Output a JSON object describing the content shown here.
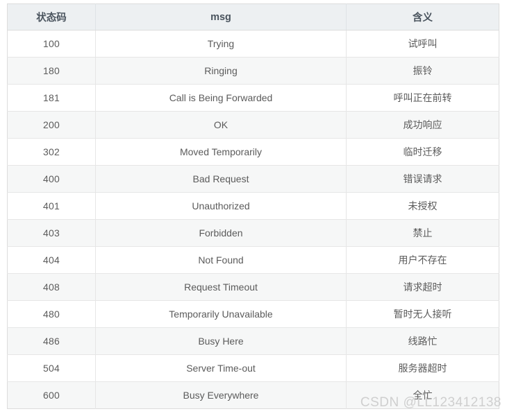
{
  "table": {
    "columns": [
      "状态码",
      "msg",
      "含义"
    ],
    "rows": [
      {
        "code": "100",
        "msg": "Trying",
        "meaning": "试呼叫"
      },
      {
        "code": "180",
        "msg": "Ringing",
        "meaning": "振铃"
      },
      {
        "code": "181",
        "msg": "Call is Being Forwarded",
        "meaning": "呼叫正在前转"
      },
      {
        "code": "200",
        "msg": "OK",
        "meaning": "成功响应"
      },
      {
        "code": "302",
        "msg": "Moved Temporarily",
        "meaning": "临时迁移"
      },
      {
        "code": "400",
        "msg": "Bad Request",
        "meaning": "错误请求"
      },
      {
        "code": "401",
        "msg": "Unauthorized",
        "meaning": "未授权"
      },
      {
        "code": "403",
        "msg": "Forbidden",
        "meaning": "禁止"
      },
      {
        "code": "404",
        "msg": "Not Found",
        "meaning": "用户不存在"
      },
      {
        "code": "408",
        "msg": "Request Timeout",
        "meaning": "请求超时"
      },
      {
        "code": "480",
        "msg": "Temporarily Unavailable",
        "meaning": "暂时无人接听"
      },
      {
        "code": "486",
        "msg": "Busy Here",
        "meaning": "线路忙"
      },
      {
        "code": "504",
        "msg": "Server Time-out",
        "meaning": "服务器超时"
      },
      {
        "code": "600",
        "msg": "Busy Everywhere",
        "meaning": "全忙"
      }
    ]
  },
  "watermark": {
    "text": "CSDN @LL123412138"
  },
  "colors": {
    "header_background": "#edf0f2",
    "zebra_background": "#f6f7f7",
    "plain_background": "#ffffff",
    "border": "#e6e6e6",
    "outer_border": "#dcdcdc",
    "header_text": "#4a545e",
    "body_text": "#5b5b5b",
    "watermark_text": "#cfcfcf"
  }
}
